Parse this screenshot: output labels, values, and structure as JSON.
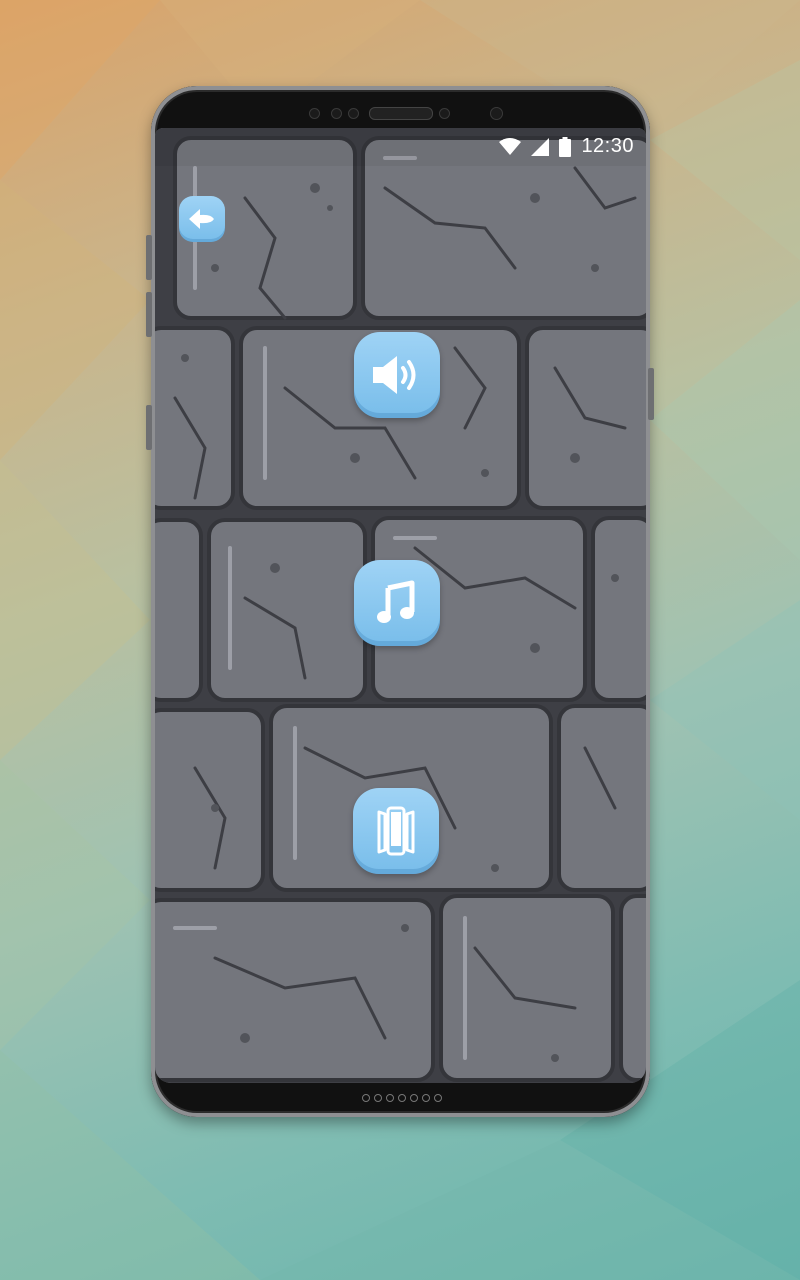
{
  "statusbar": {
    "time": "12:30",
    "icons": [
      "wifi-icon",
      "signal-icon",
      "battery-icon"
    ]
  },
  "navigation": {
    "back_icon": "back-arrow-icon"
  },
  "settings_buttons": [
    {
      "icon": "volume-icon"
    },
    {
      "icon": "music-note-icon"
    },
    {
      "icon": "vibration-icon"
    }
  ],
  "colors": {
    "button": "#80c2ee",
    "stone": "#74767d",
    "mortar": "#3c3d43"
  }
}
